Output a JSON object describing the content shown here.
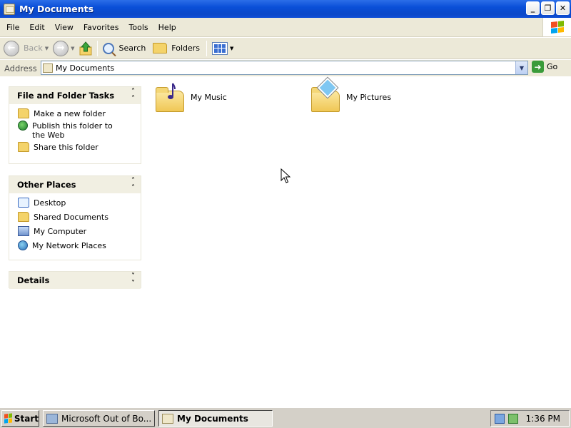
{
  "window": {
    "title": "My Documents",
    "controls": {
      "minimize": "_",
      "restore": "❐",
      "close": "✕"
    }
  },
  "menubar": {
    "items": [
      "File",
      "Edit",
      "View",
      "Favorites",
      "Tools",
      "Help"
    ]
  },
  "toolbar": {
    "back_label": "Back",
    "search_label": "Search",
    "folders_label": "Folders"
  },
  "address": {
    "label": "Address",
    "value": "My Documents",
    "go_label": "Go"
  },
  "left_pane": {
    "file_tasks": {
      "title": "File and Folder Tasks",
      "items": [
        "Make a new folder",
        "Publish this folder to the Web",
        "Share this folder"
      ]
    },
    "other_places": {
      "title": "Other Places",
      "items": [
        "Desktop",
        "Shared Documents",
        "My Computer",
        "My Network Places"
      ]
    },
    "details": {
      "title": "Details"
    }
  },
  "content": {
    "items": [
      "My Music",
      "My Pictures"
    ]
  },
  "taskbar": {
    "start_label": "Start",
    "buttons": [
      "Microsoft Out of Bo...",
      "My Documents"
    ],
    "clock": "1:36 PM"
  },
  "colors": {
    "titlebar": "#0b48c8",
    "chrome": "#ece9d8",
    "taskbar": "#d4d0c8",
    "panel_header": "#f1efe2"
  }
}
